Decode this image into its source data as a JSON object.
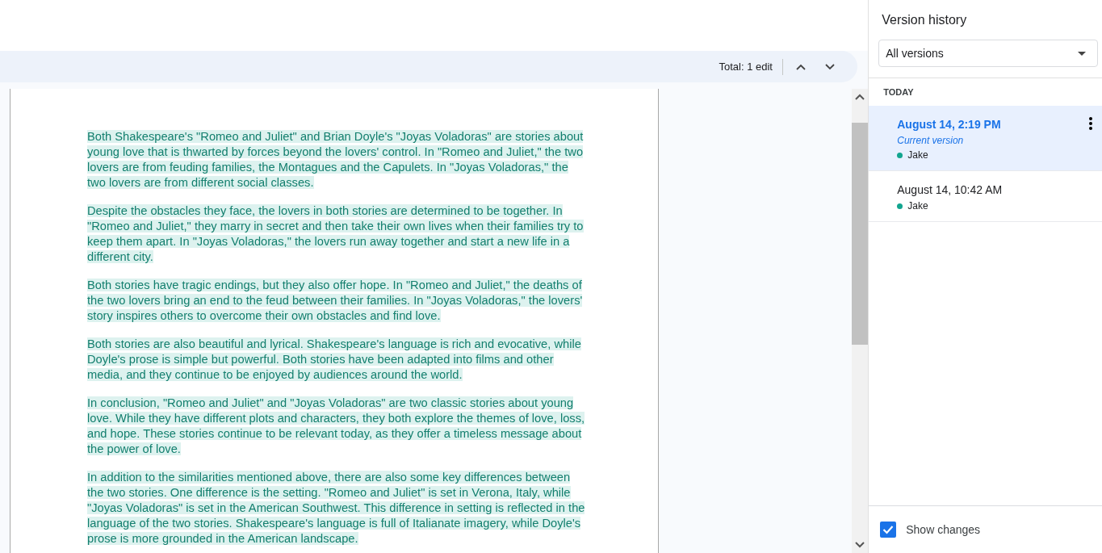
{
  "changes_bar": {
    "total": "Total: 1 edit"
  },
  "document": {
    "paragraphs": [
      "Both Shakespeare's \"Romeo and Juliet\" and Brian Doyle's \"Joyas Voladoras\" are stories about young love that is thwarted by forces beyond the lovers' control. In \"Romeo and Juliet,\" the two lovers are from feuding families, the Montagues and the Capulets. In \"Joyas Voladoras,\" the two lovers are from different social classes.",
      "Despite the obstacles they face, the lovers in both stories are determined to be together. In \"Romeo and Juliet,\" they marry in secret and then take their own lives when their families try to keep them apart. In \"Joyas Voladoras,\" the lovers run away together and start a new life in a different city.",
      "Both stories have tragic endings, but they also offer hope. In \"Romeo and Juliet,\" the deaths of the two lovers bring an end to the feud between their families. In \"Joyas Voladoras,\" the lovers' story inspires others to overcome their own obstacles and find love.",
      "Both stories are also beautiful and lyrical. Shakespeare's language is rich and evocative, while Doyle's prose is simple but powerful. Both stories have been adapted into films and other media, and they continue to be enjoyed by audiences around the world.",
      "In conclusion, \"Romeo and Juliet\" and \"Joyas Voladoras\" are two classic stories about young love. While they have different plots and characters, they both explore the themes of love, loss, and hope. These stories continue to be relevant today, as they offer a timeless message about the power of love.",
      "In addition to the similarities mentioned above, there are also some key differences between the two stories. One difference is the setting. \"Romeo and Juliet\" is set in Verona, Italy, while \"Joyas Voladoras\" is set in the American Southwest. This difference in setting is reflected in the language of the two stories. Shakespeare's language is full of Italianate imagery, while Doyle's prose is more grounded in the American landscape."
    ]
  },
  "version_history": {
    "title": "Version history",
    "filter": "All versions",
    "group": "TODAY",
    "versions": [
      {
        "time": "August 14, 2:19 PM",
        "note": "Current version",
        "author": "Jake",
        "color": "#12a58f",
        "selected": true
      },
      {
        "time": "August 14, 10:42 AM",
        "author": "Jake",
        "color": "#12a58f",
        "selected": false
      }
    ],
    "show_changes": {
      "label": "Show changes",
      "checked": true
    }
  }
}
